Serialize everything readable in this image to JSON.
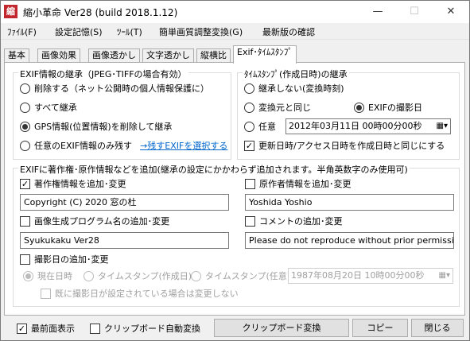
{
  "window": {
    "app_icon_char": "縮",
    "title": "縮小革命 Ver28  (build 2018.1.12)",
    "minimize": "—",
    "maximize": "☐",
    "close": "✕"
  },
  "menu": [
    "ﾌｧｲﾙ(F)",
    "設定記憶(S)",
    "ﾂｰﾙ(T)",
    "簡単画質調整変換(G)",
    "最新版の確認"
  ],
  "tabs": [
    "基本",
    "画像効果",
    "画像透かし",
    "文字透かし",
    "縦横比",
    "Exif･ﾀｲﾑｽﾀﾝﾌﾟ"
  ],
  "exif_inherit": {
    "title": "EXIF情報の継承（JPEG･TIFFの場合有効）",
    "options": [
      "削除する（ネット公開時の個人情報保護に）",
      "すべて継承",
      "GPS情報(位置情報)を削除して継承",
      "任意のEXIF情報のみ残す"
    ],
    "selected_index": 2,
    "link": "→残すEXIFを選択する"
  },
  "timestamp": {
    "title": "ﾀｲﾑｽﾀﾝﾌﾟ(作成日時)の継承",
    "no_inherit": "継承しない(変換時刻)",
    "same_as_source": "変換元と同じ",
    "exif_datetime": "EXIFの撮影日",
    "arbitrary": "任意",
    "selected": "exif_datetime",
    "date_value": "2012年03月11日  00時00分00秒",
    "sync_label": "更新日時/アクセス日時を作成日時と同じにする",
    "sync_checked": true
  },
  "add_exif": {
    "title": "EXIFに著作権･原作情報などを追加(継承の設定にかかわらず追加されます。半角英数字のみ使用可)",
    "copyright_label": "著作権情報を追加･変更",
    "copyright_checked": true,
    "copyright_value": "Copyright (C) 2020 窓の杜",
    "author_label": "原作者情報を追加･変更",
    "author_checked": false,
    "author_value": "Yoshida Yoshio",
    "software_label": "画像生成プログラム名の追加･変更",
    "software_checked": false,
    "software_value": "Syukukaku Ver28",
    "comment_label": "コメントの追加･変更",
    "comment_checked": false,
    "comment_value": "Please do not reproduce without prior permission.",
    "shoot_date_label": "撮影日の追加･変更",
    "shoot_date_checked": false,
    "now": "現在日時",
    "ts_created": "タイムスタンプ(作成日)",
    "ts_arbitrary": "タイムスタンプ(任意)",
    "shoot_date_value": "1987年08月20日  10時00分00秒",
    "keep_existing": "既に撮影日が設定されている場合は変更しない"
  },
  "bottom": {
    "topmost_label": "最前面表示",
    "topmost_checked": true,
    "clipboard_auto": "クリップボード自動変換",
    "clipboard_auto_checked": false,
    "clipboard_convert": "クリップボード変換",
    "copy": "コピー",
    "close": "閉じる"
  }
}
